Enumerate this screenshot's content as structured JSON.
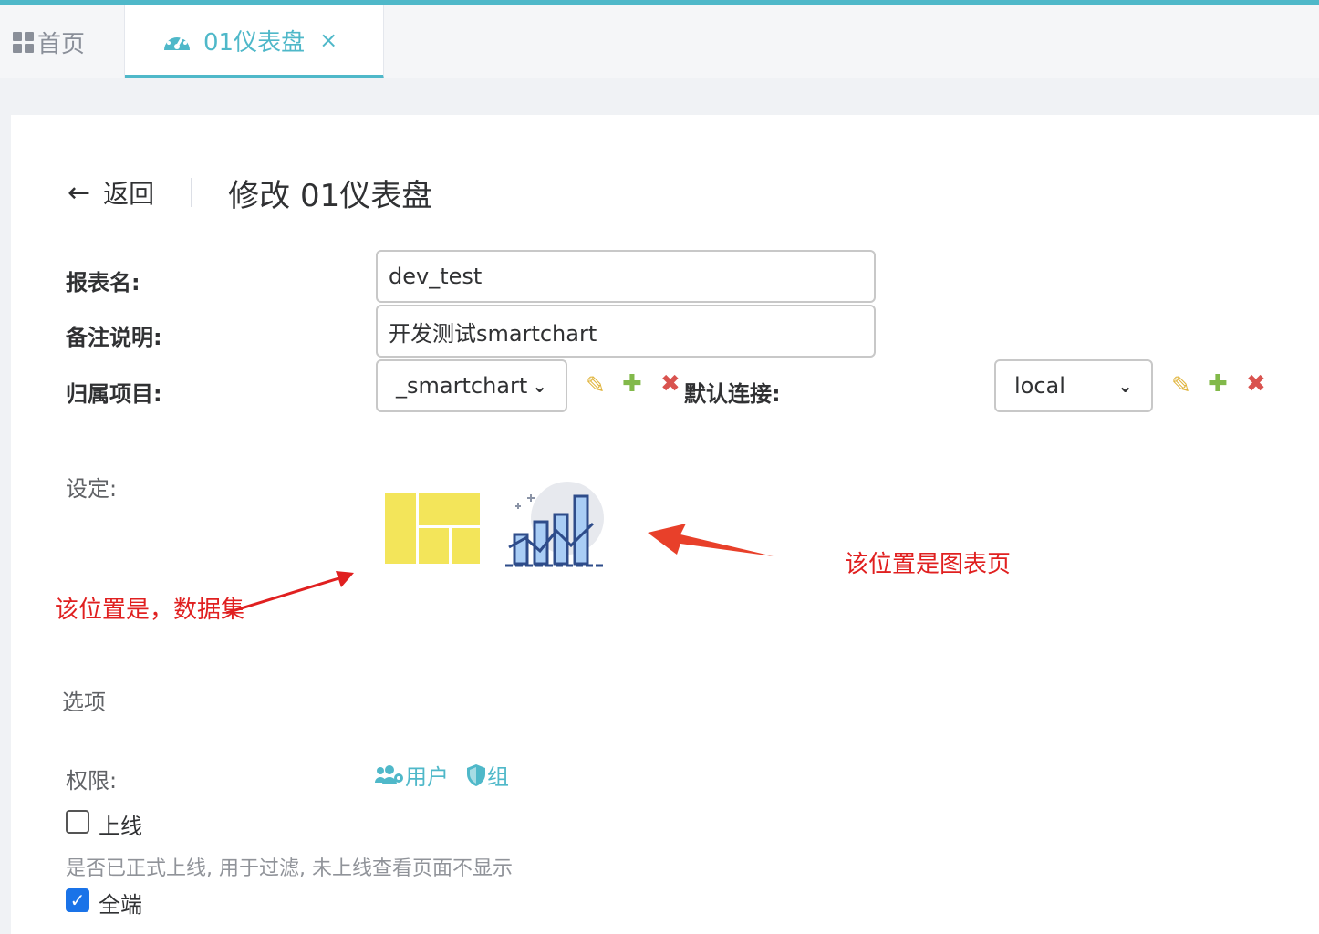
{
  "tabs": {
    "home_label": "首页",
    "active_label": "01仪表盘",
    "close_glyph": "×"
  },
  "header": {
    "back_label": "返回",
    "title": "修改 01仪表盘"
  },
  "form": {
    "report_name_label": "报表名:",
    "report_name_value": "dev_test",
    "remark_label": "备注说明:",
    "remark_value": "开发测试smartchart",
    "project_label": "归属项目:",
    "project_value": "_smartchart",
    "connection_label": "默认连接:",
    "connection_value": "local",
    "settings_label": "设定:",
    "options_label": "选项",
    "permission_label": "权限:",
    "perm_user": "用户",
    "perm_group": "组",
    "online_label": "上线",
    "online_checked": false,
    "online_hint": "是否已正式上线, 用于过滤, 未上线查看页面不显示",
    "all_end_label": "全端",
    "all_end_checked": true
  },
  "annotations": {
    "dataset_note": "该位置是，数据集",
    "chart_note": "该位置是图表页"
  },
  "colors": {
    "accent": "#4fb8c9",
    "annotation": "#e02020",
    "dataset_icon": "#f3e55a"
  }
}
